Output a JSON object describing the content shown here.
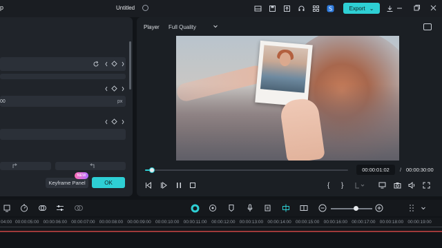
{
  "titlebar": {
    "app_name": "p",
    "doc_title": "Untitled",
    "export_label": "Export",
    "export_chevron": "⌄",
    "icons": [
      "layout-icon",
      "save-icon",
      "upload-icon",
      "headset-icon",
      "apps-icon",
      "brand-icon",
      "download-icon",
      "notification-icon"
    ]
  },
  "left_panel": {
    "px_value": "00",
    "px_unit": "px",
    "keyframe_panel_label": "Keyframe Panel",
    "new_badge": "NEW",
    "ok_label": "OK"
  },
  "player": {
    "label": "Player",
    "quality": "Full Quality",
    "progress": 0.035,
    "current_time": "00:00:01:02",
    "separator": "/",
    "total_time": "00:00:30:00",
    "mark_in": "{",
    "mark_out": "}"
  },
  "timeline": {
    "ruler_labels": [
      "04:00",
      "00:00:05:00",
      "00:00:06:00",
      "00:00:07:00",
      "00:00:08:00",
      "00:00:09:00",
      "00:00:10:00",
      "00:00:11:00",
      "00:00:12:00",
      "00:00:13:00",
      "00:00:14:00",
      "00:00:15:00",
      "00:00:16:00",
      "00:00:17:00",
      "00:00:18:00",
      "00:00:19:00"
    ],
    "zoom": 0.6
  },
  "colors": {
    "accent": "#2ecfd4",
    "background": "#111418",
    "panel": "#20242a"
  }
}
